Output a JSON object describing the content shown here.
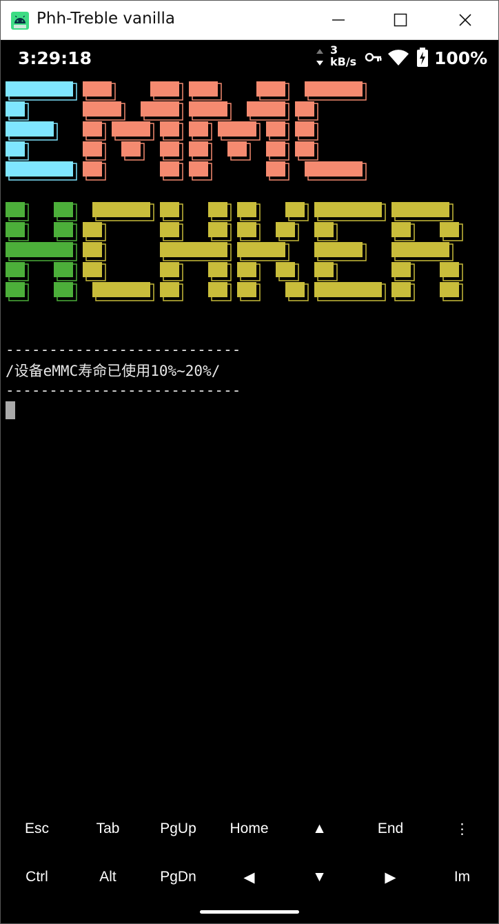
{
  "window": {
    "title": "Phh-Treble vanilla",
    "minimize_glyph": "─",
    "maximize_glyph": "☐",
    "close_glyph": "✕"
  },
  "statusbar": {
    "time": "3:29:18",
    "net_speed_value": "3",
    "net_speed_unit": "kB/s",
    "battery_percent": "100%",
    "icons": [
      "data-arrows-icon",
      "vpn-key-icon",
      "wifi-icon",
      "battery-charging-icon"
    ]
  },
  "terminal": {
    "banner_words": [
      "EMMC",
      "HCHKER"
    ],
    "banner_colors": {
      "e": "#7fe6ff",
      "mmc": "#f58a70",
      "h": "#4caf3a",
      "checker": "#c9bd3b"
    },
    "separator_top": "---------------------------",
    "message": "/设备eMMC寿命已使用10%~20%/",
    "separator_bottom": "---------------------------"
  },
  "extra_keys": {
    "row1": [
      "Esc",
      "Tab",
      "PgUp",
      "Home",
      "▲",
      "End",
      "⋮"
    ],
    "row2": [
      "Ctrl",
      "Alt",
      "PgDn",
      "◀",
      "▼",
      "▶",
      "Im"
    ]
  }
}
